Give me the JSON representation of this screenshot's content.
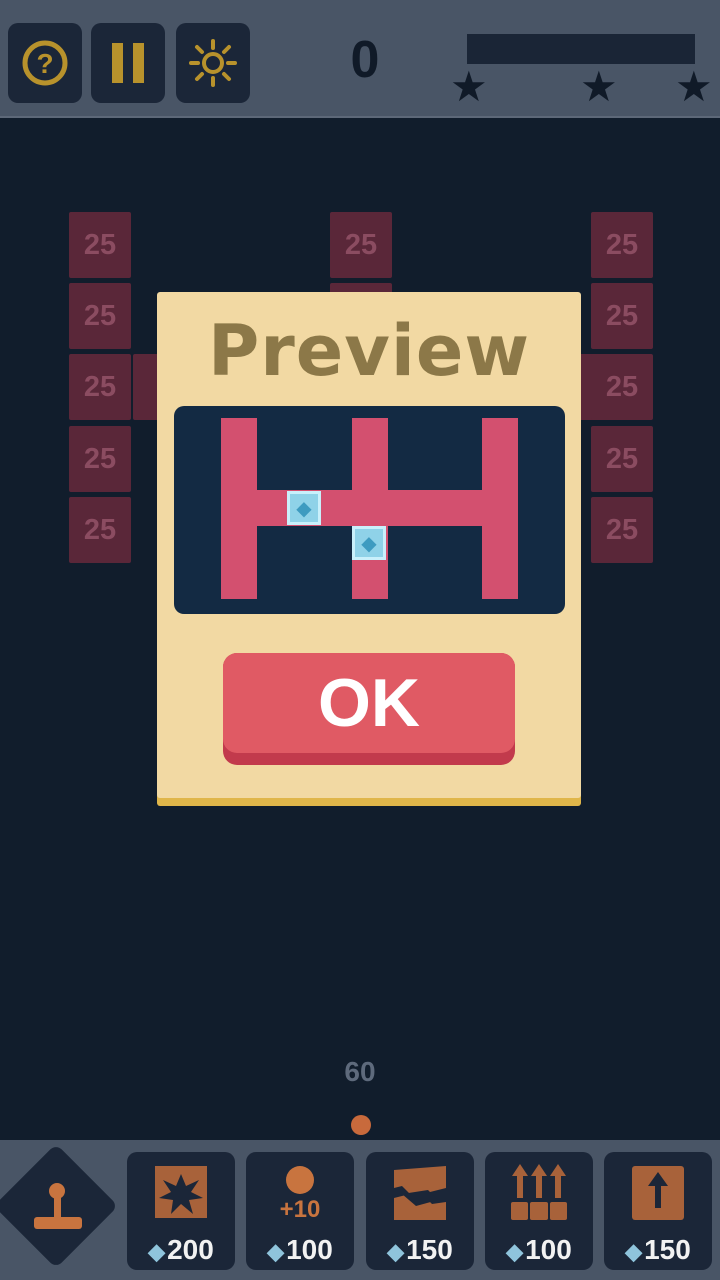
{
  "header": {
    "score": "0",
    "stars_total": 3,
    "help_icon": "question-mark-icon",
    "pause_icon": "pause-icon",
    "settings_icon": "sun-icon"
  },
  "bricks": {
    "value_label": "25"
  },
  "dialog": {
    "title": "Preview",
    "ok_label": "OK"
  },
  "ball_count": "60",
  "powerups": [
    {
      "name": "joystick",
      "icon": "joystick-icon"
    },
    {
      "name": "explode",
      "icon": "explosion-icon",
      "cost": "200"
    },
    {
      "name": "extra-balls",
      "icon": "ball-plus-icon",
      "label": "+10",
      "cost": "100"
    },
    {
      "name": "break-row",
      "icon": "broken-row-icon",
      "cost": "150"
    },
    {
      "name": "push-up",
      "icon": "arrows-up-icon",
      "cost": "100"
    },
    {
      "name": "lift-row",
      "icon": "arrow-up-box-icon",
      "cost": "150"
    }
  ],
  "colors": {
    "background": "#111d2c",
    "bar": "#495566",
    "brick": "#5a2739",
    "dialog": "#f2d9a3",
    "ok": "#e05a64",
    "preview_path": "#d3506f"
  }
}
